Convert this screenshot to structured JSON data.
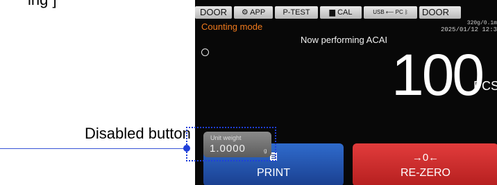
{
  "header": {
    "caption": "ing ]"
  },
  "statusbar": {
    "door_left": "DOOR",
    "app": "APP",
    "ptest": "P-TEST",
    "cal": "CAL",
    "usb": "USB",
    "pc": "PC",
    "bluetooth_icon": "bluetooth-icon",
    "door_right": "DOOR"
  },
  "display": {
    "mode": "Counting mode",
    "capacity": "320g/0.1m",
    "datetime": "2025/01/12  12:3",
    "status_message": "Now performing ACAI",
    "count_value": "100",
    "count_unit": "PCS"
  },
  "unit_weight": {
    "label": "Unit weight",
    "value": "1.0000",
    "unit": "g"
  },
  "buttons": {
    "print": {
      "label": "PRINT",
      "icon": "print-icon"
    },
    "rezero": {
      "label": "RE-ZERO",
      "icon_text": "→0←"
    }
  },
  "callout": {
    "label": "Disabled button"
  },
  "colors": {
    "mode_text": "#f07a1c",
    "print_button": "#1a3f8f",
    "rezero_button": "#b51f1f",
    "callout": "#1f3fd9"
  }
}
